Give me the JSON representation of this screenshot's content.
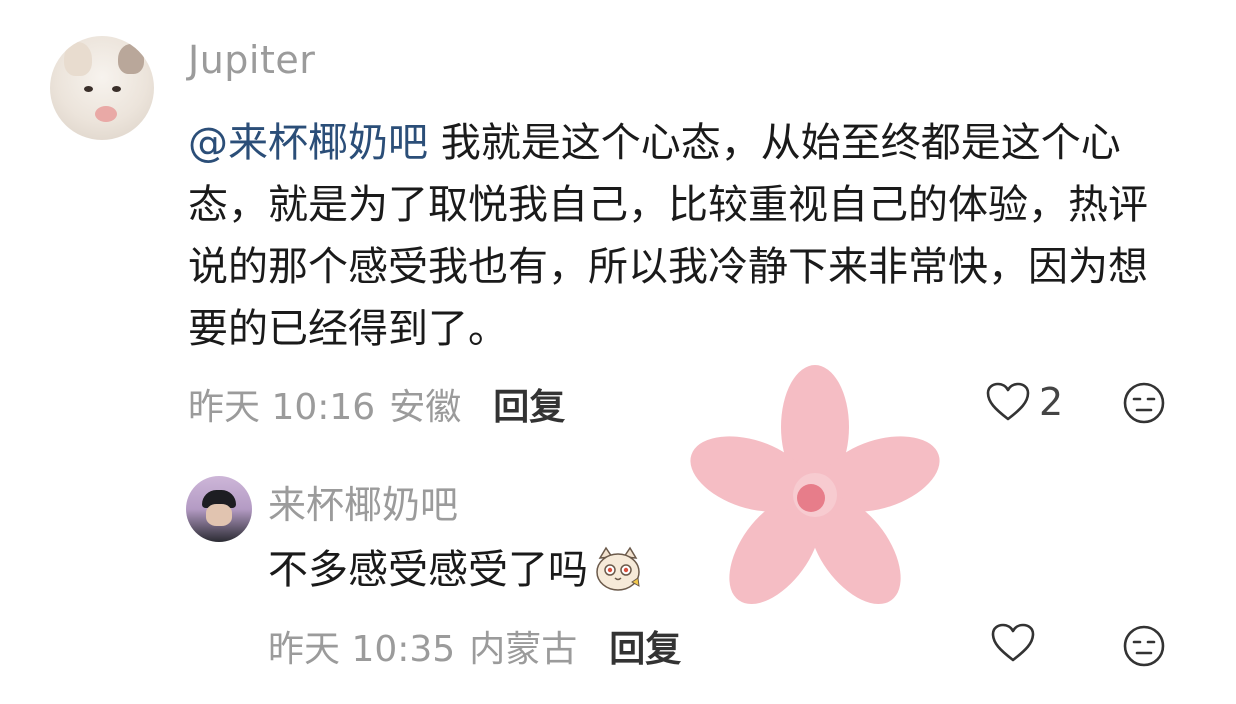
{
  "comment": {
    "username": "Jupiter",
    "mention": "@来杯椰奶吧",
    "text": " 我就是这个心态，从始至终都是这个心态，就是为了取悦我自己，比较重视自己的体验，热评说的那个感受我也有，所以我冷静下来非常快，因为想要的已经得到了。",
    "time": "昨天 10:16",
    "location": "安徽",
    "reply_label": "回复",
    "like_count": "2",
    "like_icon": "heart-outline-icon",
    "emoji_icon": "meh-face-icon"
  },
  "reply": {
    "username": "来杯椰奶吧",
    "text": "不多感受感受了吗",
    "sticker": "cat-sticker",
    "time": "昨天 10:35",
    "location": "内蒙古",
    "reply_label": "回复",
    "like_icon": "heart-outline-icon",
    "emoji_icon": "meh-face-icon"
  },
  "colors": {
    "mention": "#2b4e78",
    "meta_gray": "#9b9b9b",
    "flower_pink": "#f4b6be",
    "flower_center": "#e5707e"
  }
}
